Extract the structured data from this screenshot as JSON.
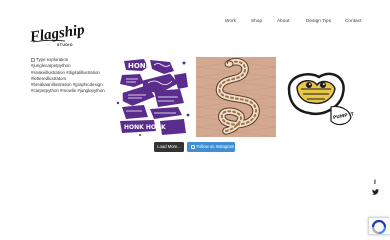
{
  "brand": {
    "name": "Flagship",
    "sub": "STUDIO"
  },
  "nav": {
    "items": [
      {
        "label": "Work"
      },
      {
        "label": "Shop"
      },
      {
        "label": "About"
      },
      {
        "label": "Design Tips"
      },
      {
        "label": "Contact"
      }
    ]
  },
  "gallery": {
    "broken_image_alt_lines": [
      "Type exploration",
      "#junglecarpetpython",
      "#snakeillustration #digitalillustration",
      "#letteredlustrators",
      "#breakaanillustration #graphicdesign",
      "#carpetpython #mowlie #junglepython"
    ],
    "tile_text": {
      "honk_top": "HONK",
      "honk_bottom": "HONK HONK",
      "sticker": "PUMP IT"
    }
  },
  "buttons": {
    "load_more": "Load More...",
    "follow": "Follow on Instagram"
  },
  "social": {
    "facebook_glyph": "f",
    "twitter_glyph": "🐦"
  },
  "colors": {
    "follow_button": "#3f8fd2",
    "load_more_button": "#333333",
    "snake_tile_bg": "#d2a890",
    "purple_art": "#5a2d8c"
  }
}
